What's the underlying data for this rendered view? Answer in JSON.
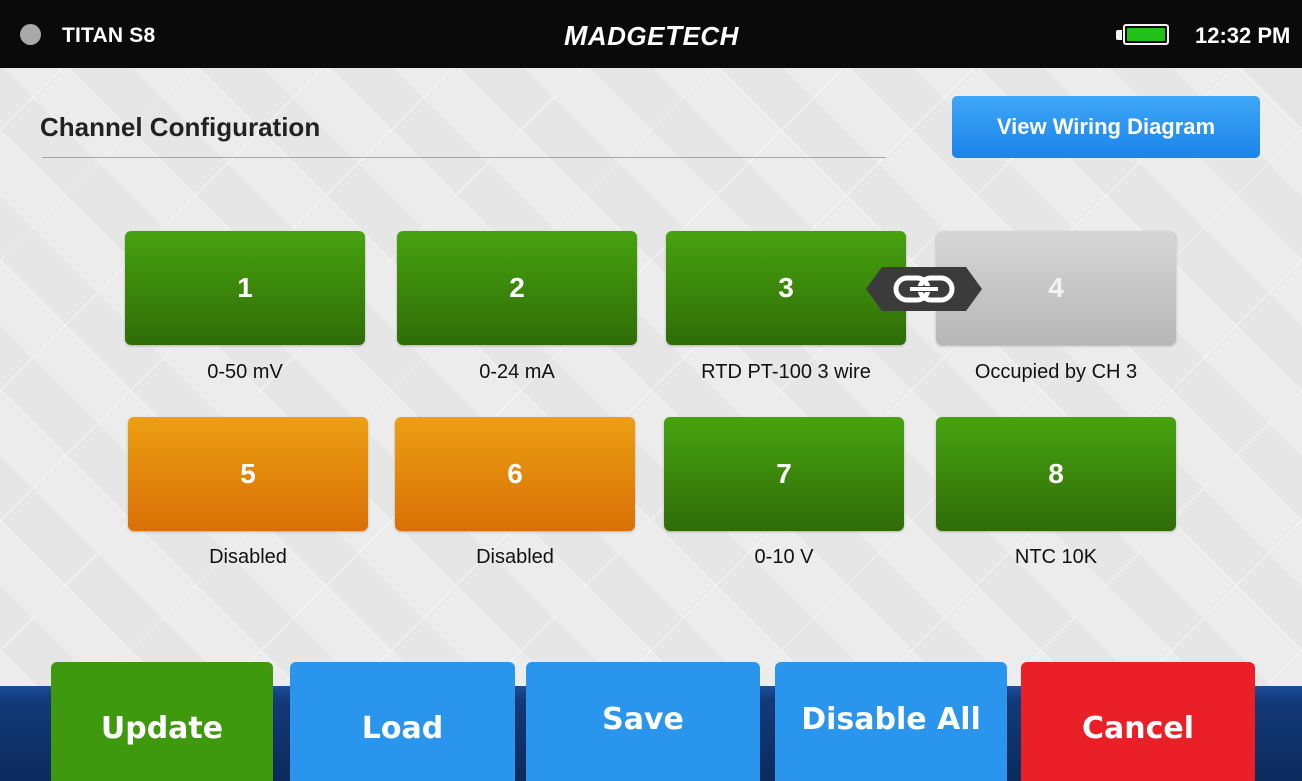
{
  "status_bar": {
    "device_name": "TITAN S8",
    "brand_logo_prefix": "M",
    "brand_logo_part1": "ADGE",
    "brand_logo_prefix2": "T",
    "brand_logo_part2": "ECH",
    "battery_icon": "battery-icon",
    "battery_color": "#21c31b",
    "time": "12:32 PM"
  },
  "header": {
    "title": "Channel Configuration",
    "wiring_button": "View Wiring Diagram"
  },
  "channels": [
    {
      "number": "1",
      "label": "0-50 mV",
      "state": "enabled",
      "color": "#3f8f0c"
    },
    {
      "number": "2",
      "label": "0-24 mA",
      "state": "enabled",
      "color": "#3f8f0c"
    },
    {
      "number": "3",
      "label": "RTD PT-100 3 wire",
      "state": "enabled",
      "color": "#3f8f0c"
    },
    {
      "number": "4",
      "label": "Occupied by CH 3",
      "state": "occupied",
      "color": "#c4c4c4"
    },
    {
      "number": "5",
      "label": "Disabled",
      "state": "disabled",
      "color": "#e58a0b"
    },
    {
      "number": "6",
      "label": "Disabled",
      "state": "disabled",
      "color": "#e58a0b"
    },
    {
      "number": "7",
      "label": "0-10 V",
      "state": "enabled",
      "color": "#3f8f0c"
    },
    {
      "number": "8",
      "label": "NTC 10K",
      "state": "enabled",
      "color": "#3f8f0c"
    }
  ],
  "link_icon": "chain-link-icon",
  "footer": {
    "update": "Update",
    "load": "Load",
    "save": "Save",
    "disable_all": "Disable All",
    "cancel": "Cancel"
  }
}
